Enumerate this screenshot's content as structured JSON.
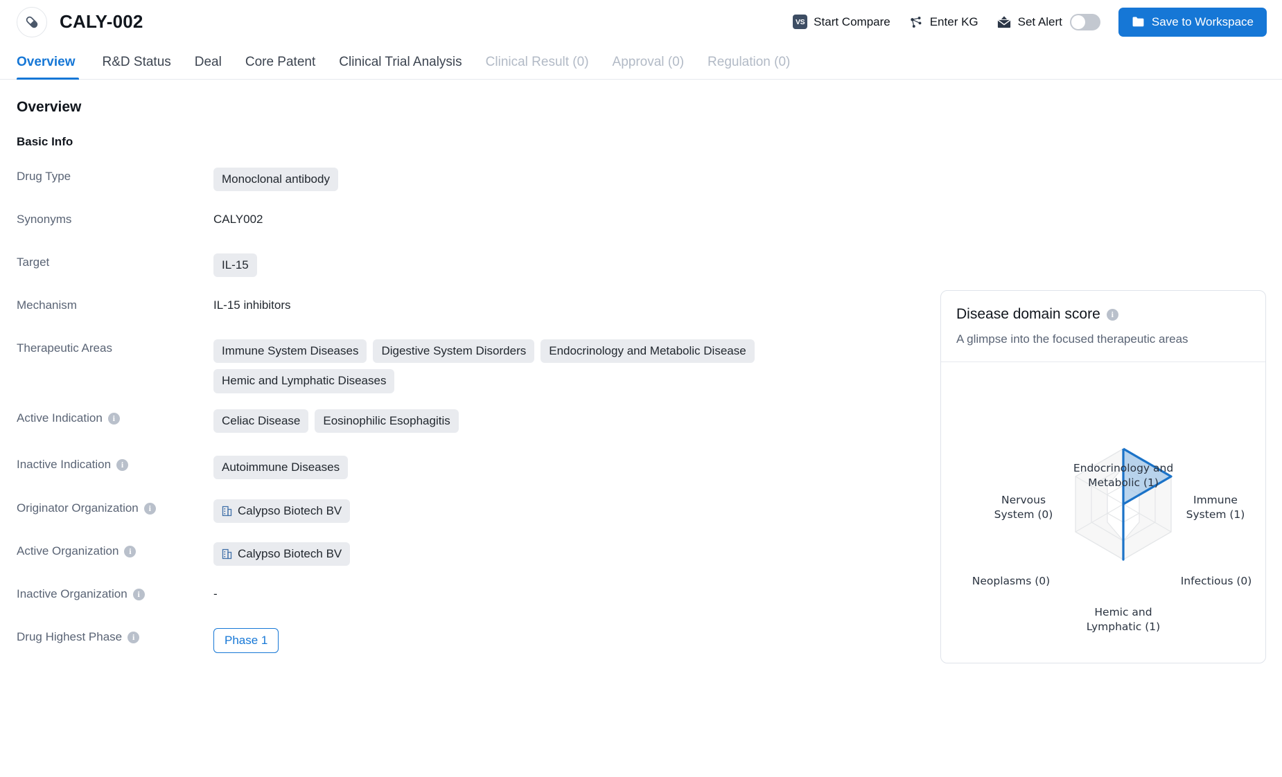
{
  "header": {
    "drug_icon": "capsule-icon",
    "title": "CALY-002",
    "actions": [
      {
        "name": "start-compare",
        "icon": "vs-icon",
        "label": "Start Compare"
      },
      {
        "name": "enter-kg",
        "icon": "knowledge-graph-icon",
        "label": "Enter KG"
      },
      {
        "name": "set-alert",
        "icon": "alert-mail-icon",
        "label": "Set Alert",
        "toggle_on": false
      }
    ],
    "save_button": {
      "icon": "folder-icon",
      "label": "Save to Workspace",
      "color": "#1677d6"
    }
  },
  "tabs": [
    {
      "label": "Overview",
      "active": true,
      "disabled": false
    },
    {
      "label": "R&D Status",
      "active": false,
      "disabled": false
    },
    {
      "label": "Deal",
      "active": false,
      "disabled": false
    },
    {
      "label": "Core Patent",
      "active": false,
      "disabled": false
    },
    {
      "label": "Clinical Trial Analysis",
      "active": false,
      "disabled": false
    },
    {
      "label": "Clinical Result (0)",
      "active": false,
      "disabled": true
    },
    {
      "label": "Approval (0)",
      "active": false,
      "disabled": true
    },
    {
      "label": "Regulation (0)",
      "active": false,
      "disabled": true
    }
  ],
  "overview": {
    "section_title": "Overview",
    "subsection_title": "Basic Info",
    "fields": [
      {
        "label": "Drug Type",
        "info": false,
        "type": "chips",
        "values": [
          "Monoclonal antibody"
        ]
      },
      {
        "label": "Synonyms",
        "info": false,
        "type": "text",
        "values": [
          "CALY002"
        ]
      },
      {
        "label": "Target",
        "info": false,
        "type": "chips",
        "values": [
          "IL-15"
        ]
      },
      {
        "label": "Mechanism",
        "info": false,
        "type": "text",
        "values": [
          "IL-15 inhibitors"
        ]
      },
      {
        "label": "Therapeutic Areas",
        "info": false,
        "type": "chips",
        "values": [
          "Immune System Diseases",
          "Digestive System Disorders",
          "Endocrinology and Metabolic Disease",
          "Hemic and Lymphatic Diseases"
        ]
      },
      {
        "label": "Active Indication",
        "info": true,
        "type": "chips",
        "values": [
          "Celiac Disease",
          "Eosinophilic Esophagitis"
        ]
      },
      {
        "label": "Inactive Indication",
        "info": true,
        "type": "chips",
        "values": [
          "Autoimmune Diseases"
        ]
      },
      {
        "label": "Originator Organization",
        "info": true,
        "type": "org-chips",
        "values": [
          "Calypso Biotech BV"
        ]
      },
      {
        "label": "Active Organization",
        "info": true,
        "type": "org-chips",
        "values": [
          "Calypso Biotech BV"
        ]
      },
      {
        "label": "Inactive Organization",
        "info": true,
        "type": "text",
        "values": [
          "-"
        ]
      },
      {
        "label": "Drug Highest Phase",
        "info": true,
        "type": "phase",
        "values": [
          "Phase 1"
        ]
      }
    ]
  },
  "radar_card": {
    "title": "Disease domain score",
    "info": true,
    "subtitle": "A glimpse into the focused therapeutic areas"
  },
  "chart_data": {
    "type": "radar",
    "title": "Disease domain score",
    "subtitle": "A glimpse into the focused therapeutic areas",
    "categories": [
      "Endocrinology and Metabolic",
      "Immune System",
      "Infectious",
      "Hemic and Lymphatic",
      "Neoplasms",
      "Nervous System"
    ],
    "tick_labels": [
      "Endocrinology and\nMetabolic (1)",
      "Immune\nSystem (1)",
      "Infectious (0)",
      "Hemic and\nLymphatic (1)",
      "Neoplasms (0)",
      "Nervous\nSystem (0)"
    ],
    "values": [
      1,
      1,
      0,
      1,
      0,
      0
    ],
    "rmax": 3,
    "rings": 3,
    "grid": true,
    "legend": "none",
    "series_color": "#1b73c8",
    "fill_color": "#9fc5e8",
    "grid_color": "#e4e6e8"
  }
}
